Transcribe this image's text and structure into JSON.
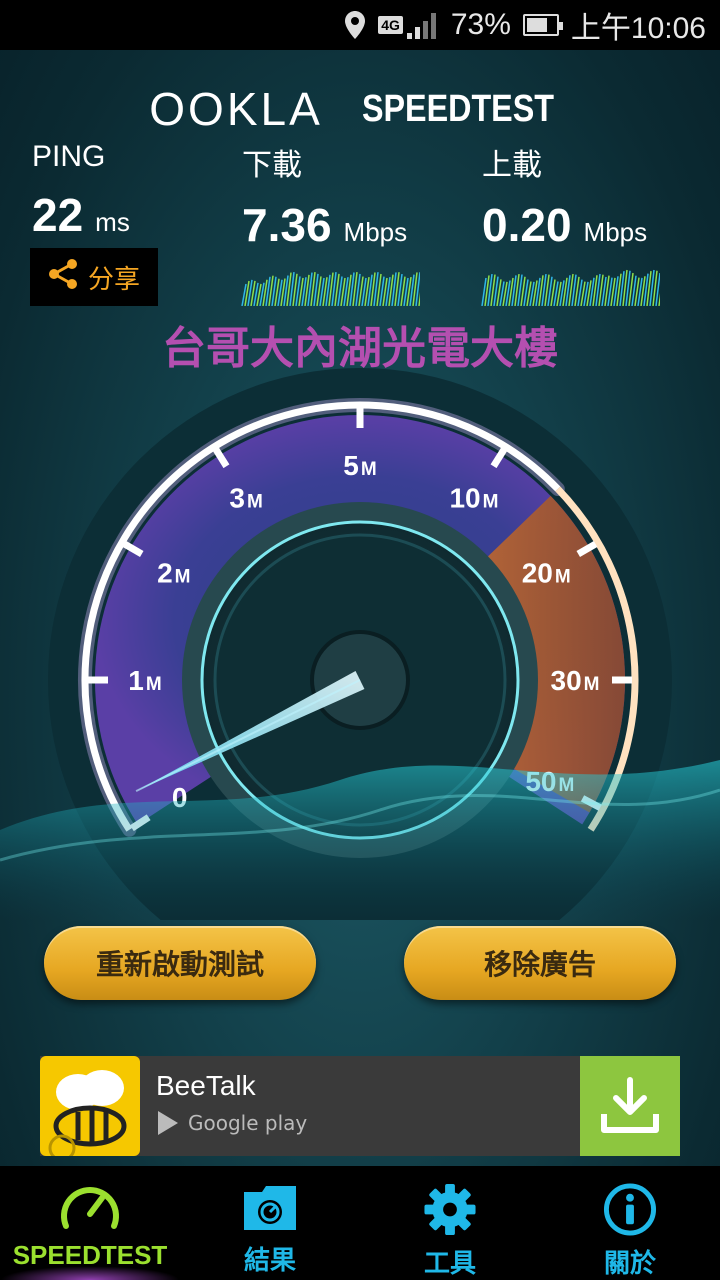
{
  "status_bar": {
    "network": "4G",
    "battery": "73%",
    "battery_level": 0.73,
    "time": "上午10:06",
    "icons": [
      "location-icon",
      "signal-icon",
      "battery-icon"
    ]
  },
  "brand": {
    "ookla": "OOKLA",
    "speedtest": "SPEEDTEST"
  },
  "ping": {
    "label": "PING",
    "value": "22",
    "unit": "ms"
  },
  "download": {
    "label": "下載",
    "value": "7.36",
    "unit": "Mbps"
  },
  "upload": {
    "label": "上載",
    "value": "0.20",
    "unit": "Mbps"
  },
  "share": {
    "label": "分享",
    "icon": "share-icon",
    "color": "#f5a623"
  },
  "location": "台哥大內湖光電大樓",
  "gauge": {
    "ticks": [
      {
        "num": "0",
        "unit": ""
      },
      {
        "num": "1",
        "unit": "M"
      },
      {
        "num": "2",
        "unit": "M"
      },
      {
        "num": "3",
        "unit": "M"
      },
      {
        "num": "5",
        "unit": "M"
      },
      {
        "num": "10",
        "unit": "M"
      },
      {
        "num": "20",
        "unit": "M"
      },
      {
        "num": "30",
        "unit": "M"
      },
      {
        "num": "50",
        "unit": "M"
      }
    ],
    "needle_value_mbps": 0.2
  },
  "buttons": {
    "restart": "重新啟動測試",
    "remove_ads": "移除廣告"
  },
  "ad": {
    "title": "BeeTalk",
    "store": "Google play"
  },
  "nav": [
    {
      "label": "SPEEDTEST",
      "icon": "speedometer-icon",
      "active": true
    },
    {
      "label": "結果",
      "icon": "results-icon",
      "active": false
    },
    {
      "label": "工具",
      "icon": "gear-icon",
      "active": false
    },
    {
      "label": "關於",
      "icon": "info-icon",
      "active": false
    }
  ],
  "colors": {
    "accent_green": "#9be02f",
    "accent_blue": "#1fb8e8",
    "location_purple": "#b44fb0",
    "button_gold": "#e6a722"
  }
}
